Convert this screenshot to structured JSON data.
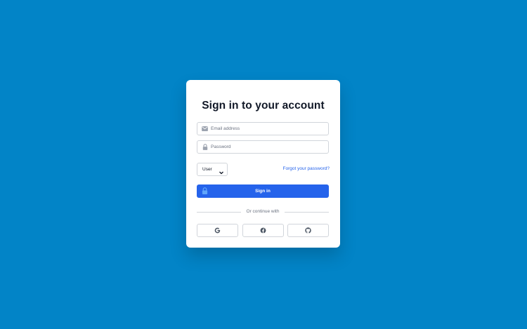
{
  "login": {
    "title": "Sign in to your account",
    "email": {
      "placeholder": "Email address",
      "value": ""
    },
    "password": {
      "placeholder": "Password",
      "value": ""
    },
    "role": {
      "selected": "User"
    },
    "forgot_link": "Forgot your password?",
    "signin_label": "Sign in",
    "divider_text": "Or continue with",
    "social": [
      {
        "name": "google",
        "icon": "google-icon"
      },
      {
        "name": "facebook",
        "icon": "facebook-icon"
      },
      {
        "name": "github",
        "icon": "github-icon"
      }
    ]
  },
  "colors": {
    "background": "#0284c7",
    "card": "#ffffff",
    "primary": "#2563eb",
    "title": "#111827",
    "muted": "#6b7280",
    "border": "#d1d5db"
  }
}
